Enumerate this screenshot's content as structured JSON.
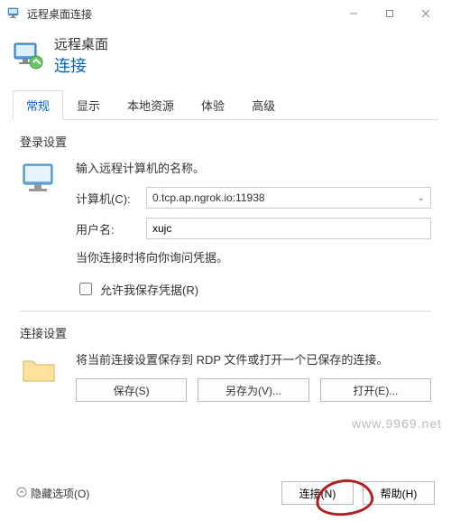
{
  "titlebar": {
    "title": "远程桌面连接"
  },
  "header": {
    "line1": "远程桌面",
    "line2": "连接"
  },
  "tabs": [
    "常规",
    "显示",
    "本地资源",
    "体验",
    "高级"
  ],
  "login": {
    "section_title": "登录设置",
    "instruction": "输入远程计算机的名称。",
    "computer_label": "计算机(C):",
    "computer_value": "0.tcp.ap.ngrok.io:11938",
    "username_label": "用户名:",
    "username_value": "xujc",
    "cred_note": "当你连接时将向你询问凭据。",
    "save_cred_label": "允许我保存凭据(R)"
  },
  "conn": {
    "section_title": "连接设置",
    "desc": "将当前连接设置保存到 RDP 文件或打开一个已保存的连接。",
    "save": "保存(S)",
    "save_as": "另存为(V)...",
    "open": "打开(E)..."
  },
  "footer": {
    "hide": "隐藏选项(O)",
    "connect": "连接(N)",
    "help": "帮助(H)"
  },
  "watermark": "www.9969.net"
}
